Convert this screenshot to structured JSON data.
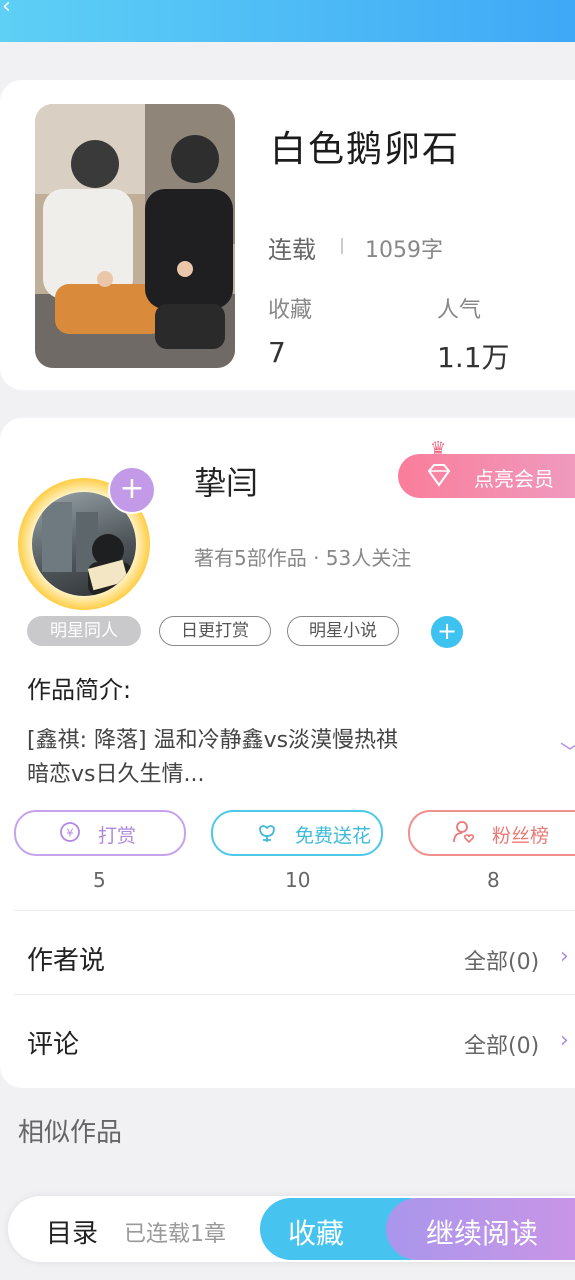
{
  "header": {
    "back_icon": "back-arrow-icon"
  },
  "book": {
    "title": "白色鹅卵石",
    "status": "连载",
    "word_count": "1059字",
    "favorites_label": "收藏",
    "favorites_value": "7",
    "popularity_label": "人气",
    "popularity_value": "1.1万"
  },
  "author": {
    "name": "挚闫",
    "stats": "著有5部作品 · 53人关注",
    "vip_label": "点亮会员",
    "tags": [
      "明星同人",
      "日更打赏",
      "明星小说"
    ],
    "intro_title": "作品简介:",
    "intro_line1": "[鑫祺: 降落] 温和冷静鑫vs淡漠慢热祺",
    "intro_line2": "暗恋vs日久生情..."
  },
  "actions": [
    {
      "label": "打赏",
      "count": "5",
      "icon": "coin-icon"
    },
    {
      "label": "免费送花",
      "count": "10",
      "icon": "flower-icon"
    },
    {
      "label": "粉丝榜",
      "count": "8",
      "icon": "fan-heart-icon"
    }
  ],
  "sections": {
    "author_says_label": "作者说",
    "author_says_value": "全部(0)",
    "comments_label": "评论",
    "comments_value": "全部(0)",
    "similar_label": "相似作品"
  },
  "bottom": {
    "toc_label": "目录",
    "toc_sub": "已连载1章",
    "favorite_button": "收藏",
    "read_button": "继续阅读"
  },
  "colors": {
    "accent_blue": "#46c4ef",
    "accent_purple": "#b38ae0",
    "vip_pink": "#fa7d9a"
  }
}
